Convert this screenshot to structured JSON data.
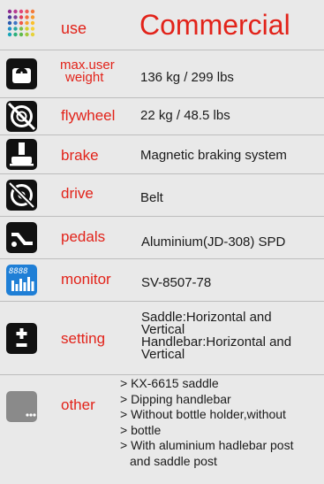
{
  "rows": {
    "use": {
      "label": "use",
      "value": "Commercial",
      "icon": "color-dots-icon"
    },
    "max_user_weight": {
      "label_line1": "max.user",
      "label_line2": "weight",
      "value": "136 kg / 299 lbs",
      "icon": "scale-icon"
    },
    "flywheel": {
      "label": "flywheel",
      "value": "22 kg / 48.5 lbs",
      "icon": "flywheel-icon"
    },
    "brake": {
      "label": "brake",
      "value": "Magnetic braking system",
      "icon": "brake-icon"
    },
    "drive": {
      "label": "drive",
      "value": "Belt",
      "icon": "drive-icon"
    },
    "pedals": {
      "label": "pedals",
      "value": "Aluminium(JD-308) SPD",
      "icon": "pedal-icon"
    },
    "monitor": {
      "label": "monitor",
      "value": "SV-8507-78",
      "icon": "monitor-icon",
      "display": "8888"
    },
    "setting": {
      "label": "setting",
      "lines": [
        "Saddle:Horizontal and",
        "Vertical",
        "Handlebar:Horizontal and",
        "Vertical"
      ],
      "icon": "plus-minus-icon"
    },
    "other": {
      "label": "other",
      "icon": "more-icon",
      "items": [
        "> KX-6615 saddle",
        "> Dipping handlebar",
        "> Without bottle holder,without",
        "> bottle",
        "> With aluminium hadlebar post",
        "and saddle post"
      ]
    }
  },
  "colors": {
    "label": "#e2231a",
    "background": "#e9e9e9",
    "icon": "#111111",
    "monitor": "#1f7fd6",
    "other_icon": "#8a8a8a"
  }
}
